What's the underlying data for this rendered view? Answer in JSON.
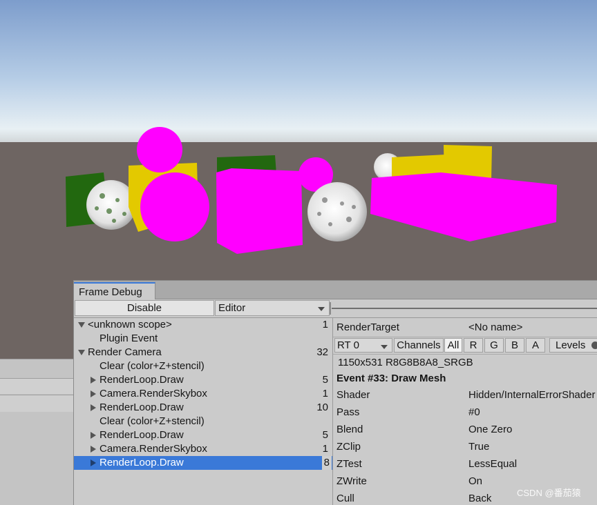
{
  "viewport": {
    "sky_top_color": "#7fa1cf",
    "horizon_color": "#e7eff4",
    "ground_color": "#6e6562"
  },
  "frame_debug": {
    "tab_title": "Frame Debug",
    "disable_button": "Disable",
    "target_dropdown": "Editor",
    "tree": [
      {
        "label": "<unknown scope>",
        "count": "1",
        "expand": "down"
      },
      {
        "label": "Plugin Event",
        "count": "",
        "expand": "none"
      },
      {
        "label": "Render Camera",
        "count": "32",
        "expand": "down"
      },
      {
        "label": "Clear (color+Z+stencil)",
        "count": "",
        "expand": "none"
      },
      {
        "label": "RenderLoop.Draw",
        "count": "5",
        "expand": "right"
      },
      {
        "label": "Camera.RenderSkybox",
        "count": "1",
        "expand": "right"
      },
      {
        "label": "RenderLoop.Draw",
        "count": "10",
        "expand": "right"
      },
      {
        "label": "Clear (color+Z+stencil)",
        "count": "",
        "expand": "none"
      },
      {
        "label": "RenderLoop.Draw",
        "count": "5",
        "expand": "right"
      },
      {
        "label": "Camera.RenderSkybox",
        "count": "1",
        "expand": "right"
      },
      {
        "label": "RenderLoop.Draw",
        "count": "8",
        "expand": "right",
        "selected": true
      }
    ],
    "details": {
      "render_target_label": "RenderTarget",
      "render_target_value": "<No name>",
      "rt_select": "RT 0",
      "channels_label": "Channels",
      "channels": [
        "All",
        "R",
        "G",
        "B",
        "A"
      ],
      "levels_label": "Levels",
      "resolution": "1150x531 R8G8B8A8_SRGB",
      "event_title": "Event #33: Draw Mesh",
      "props": [
        {
          "key": "Shader",
          "value": "Hidden/InternalErrorShader"
        },
        {
          "key": "Pass",
          "value": "#0"
        },
        {
          "key": "Blend",
          "value": "One Zero"
        },
        {
          "key": "ZClip",
          "value": "True"
        },
        {
          "key": "ZTest",
          "value": "LessEqual"
        },
        {
          "key": "ZWrite",
          "value": "On"
        },
        {
          "key": "Cull",
          "value": "Back"
        }
      ]
    }
  },
  "watermark": "CSDN @番茄猿"
}
